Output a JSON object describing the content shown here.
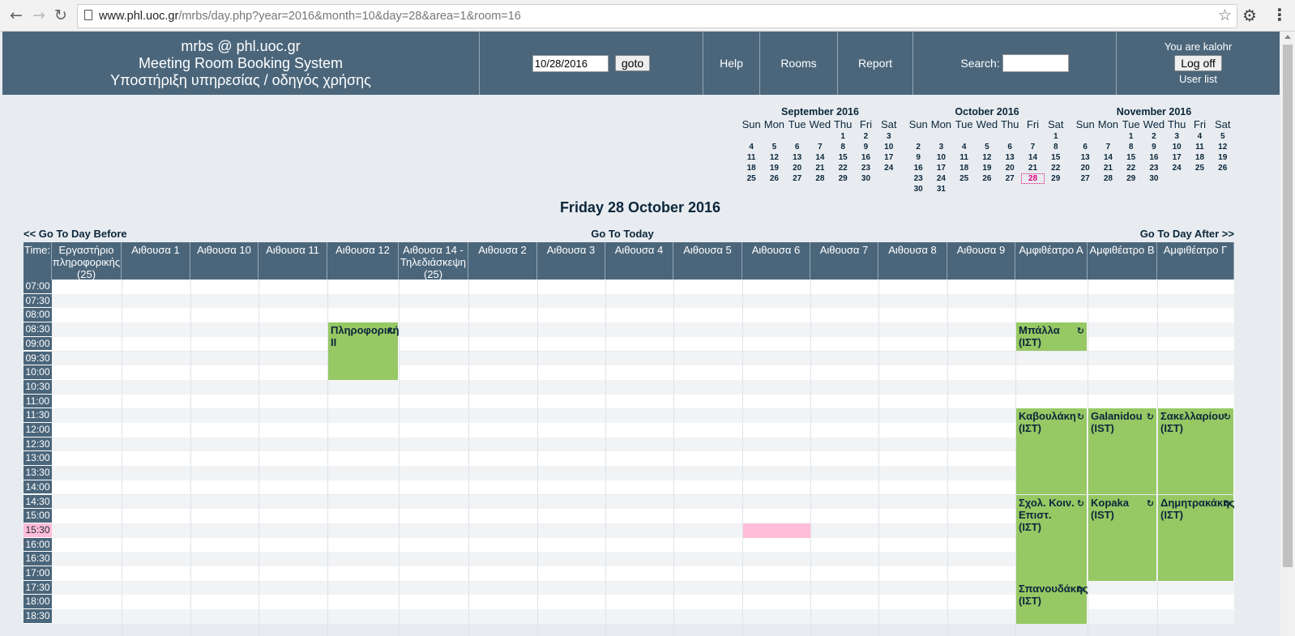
{
  "browser": {
    "url_domain": "www.phl.uoc.gr",
    "url_path": "/mrbs/day.php?year=2016&month=10&day=28&area=1&room=16"
  },
  "header": {
    "brand_line1": "mrbs @ phl.uoc.gr",
    "brand_line2": "Meeting Room Booking System",
    "brand_line3": "Υποστήριξη υπηρεσίας / οδηγός χρήσης",
    "date_value": "10/28/2016",
    "goto_label": "goto",
    "help": "Help",
    "rooms": "Rooms",
    "report": "Report",
    "search_label": "Search:",
    "user_text": "You are kalohr",
    "logoff_label": "Log off",
    "userlist_label": "User list"
  },
  "calendars": [
    {
      "title": "September 2016",
      "start": 4,
      "days": 30,
      "today": null
    },
    {
      "title": "October 2016",
      "start": 6,
      "days": 31,
      "today": 28
    },
    {
      "title": "November 2016",
      "start": 2,
      "days": 30,
      "today": null
    }
  ],
  "weekdays": [
    "Sun",
    "Mon",
    "Tue",
    "Wed",
    "Thu",
    "Fri",
    "Sat"
  ],
  "day": {
    "title": "Friday 28 October 2016",
    "prev": "<< Go To Day Before",
    "today": "Go To Today",
    "next": "Go To Day After >>"
  },
  "time_header": "Time:",
  "rooms": [
    "Εργαστήριο πληροφορικής (25)",
    "Αιθουσα 1",
    "Αιθουσα 10",
    "Αιθουσα 11",
    "Αιθουσα 12",
    "Αιθουσα 14 - Τηλεδιάσκεψη (25)",
    "Αιθουσα 2",
    "Αιθουσα 3",
    "Αιθουσα 4",
    "Αιθουσα 5",
    "Αιθουσα 6",
    "Αιθουσα 7",
    "Αιθουσα 8",
    "Αιθουσα 9",
    "Αμφιθέατρο Α",
    "Αμφιθέατρο Β",
    "Αμφιθέατρο Γ"
  ],
  "times": [
    "07:00",
    "07:30",
    "08:00",
    "08:30",
    "09:00",
    "09:30",
    "10:00",
    "10:30",
    "11:00",
    "11:30",
    "12:00",
    "12:30",
    "13:00",
    "13:30",
    "14:00",
    "14:30",
    "15:00",
    "15:30",
    "16:00",
    "16:30",
    "17:00",
    "17:30",
    "18:00",
    "18:30"
  ],
  "current_time": "15:30",
  "bookings": [
    {
      "room": 4,
      "start": 3,
      "slots": 4,
      "text": "Πληροφορική ΙΙ"
    },
    {
      "room": 14,
      "start": 3,
      "slots": 2,
      "text": "Μπάλλα (ΙΣΤ)"
    },
    {
      "room": 14,
      "start": 9,
      "slots": 6,
      "text": "Καβουλάκη (ΙΣΤ)"
    },
    {
      "room": 15,
      "start": 9,
      "slots": 6,
      "text": "Galanidou (IST)"
    },
    {
      "room": 16,
      "start": 9,
      "slots": 6,
      "text": "Σακελλαρίου (ΙΣΤ)"
    },
    {
      "room": 14,
      "start": 15,
      "slots": 6,
      "text": "Σχολ. Κοιν. Επιστ. (ΙΣΤ)"
    },
    {
      "room": 15,
      "start": 15,
      "slots": 6,
      "text": "Kopaka (IST)"
    },
    {
      "room": 16,
      "start": 15,
      "slots": 6,
      "text": "Δημητρακάκης (ΙΣΤ)"
    },
    {
      "room": 14,
      "start": 21,
      "slots": 3,
      "text": "Σπανουδάκης (ΙΣΤ)"
    }
  ],
  "highlight": {
    "room": 10,
    "slot": 17
  },
  "icons": {
    "repeat": "repeat-icon",
    "back": "back-arrow-icon",
    "forward": "forward-arrow-icon",
    "reload": "reload-icon",
    "star": "star-icon",
    "settings": "gear-icon",
    "menu": "kebab-menu-icon"
  }
}
